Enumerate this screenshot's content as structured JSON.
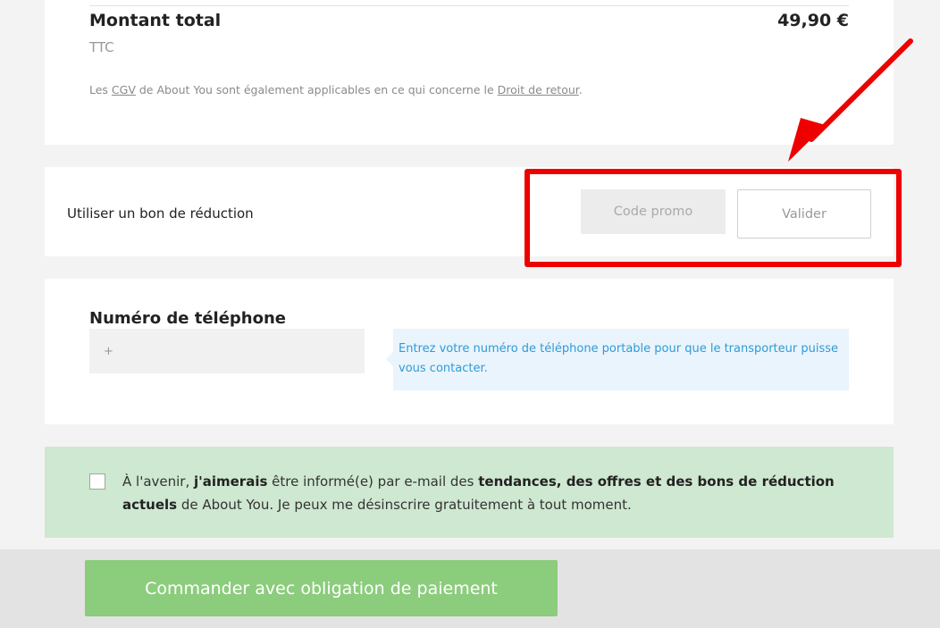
{
  "summary": {
    "total_label": "Montant total",
    "total_amount": "49,90 €",
    "tax_label": "TTC",
    "legal_prefix": "Les ",
    "cgv_link": "CGV",
    "legal_middle": " de About You sont également applicables en ce qui concerne le ",
    "return_link": "Droit de retour",
    "legal_suffix": "."
  },
  "promo": {
    "label": "Utiliser un bon de réduction",
    "input_placeholder": "Code promo",
    "input_value": "",
    "validate_label": "Valider"
  },
  "phone": {
    "title": "Numéro de téléphone",
    "input_placeholder": "+",
    "input_value": "",
    "hint": "Entrez votre numéro de téléphone portable pour que le transporteur puisse vous contacter."
  },
  "newsletter": {
    "checked": false,
    "text_1": "À l'avenir, ",
    "bold_1": "j'aimerais",
    "text_2": " être informé(e) par e-mail des ",
    "bold_2": "tendances, des offres et des bons de réduction actuels",
    "text_3": " de About You. Je peux me désinscrire gratuitement à tout moment."
  },
  "checkout": {
    "order_button_label": "Commander avec obligation de paiement"
  },
  "colors": {
    "annotation_red": "#ee0000",
    "order_button_green": "#8ccc7d",
    "newsletter_bg": "#cfe8d1",
    "hint_text_blue": "#2f9bd6"
  }
}
